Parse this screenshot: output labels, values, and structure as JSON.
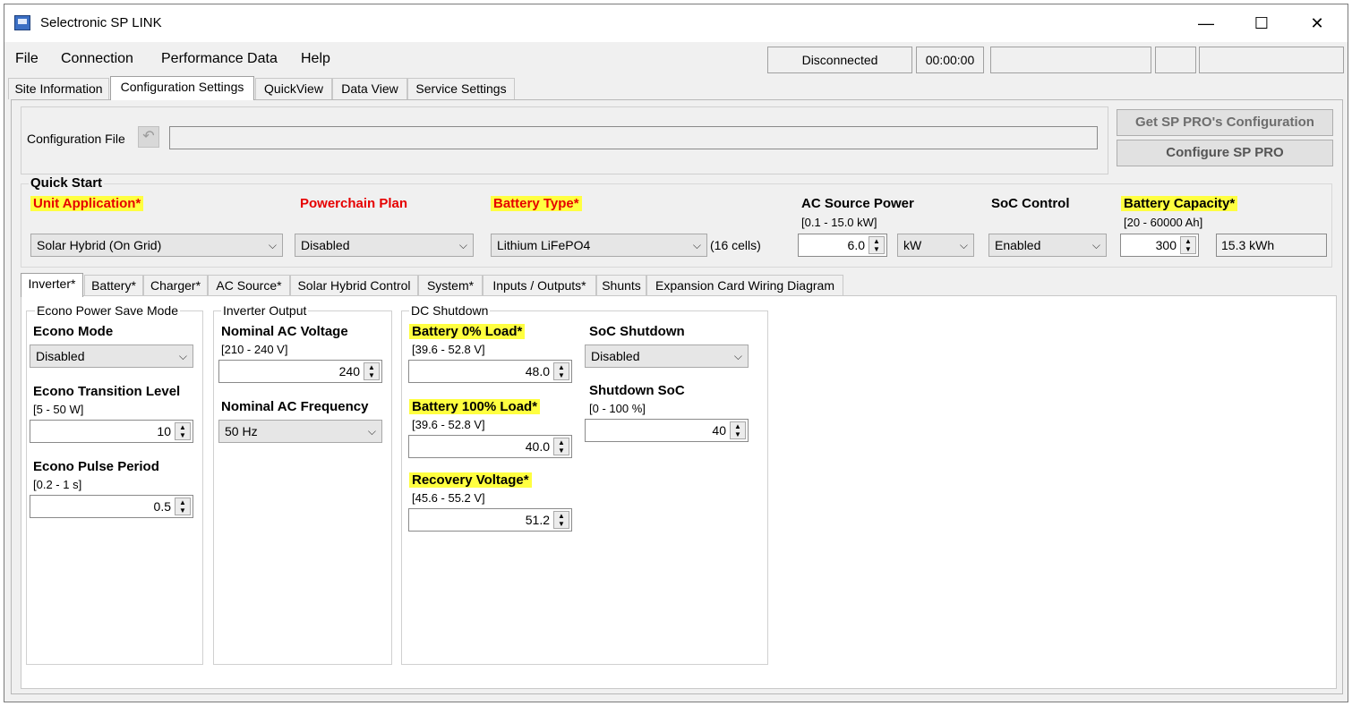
{
  "window": {
    "title": "Selectronic SP LINK",
    "minimize": "—",
    "maximize": "☐",
    "close": "✕"
  },
  "menu": {
    "file": "File",
    "connection": "Connection",
    "performance": "Performance Data",
    "help": "Help"
  },
  "status": {
    "connection": "Disconnected",
    "timer": "00:00:00"
  },
  "tabs": [
    "Site Information",
    "Configuration Settings",
    "QuickView",
    "Data View",
    "Service Settings"
  ],
  "config": {
    "file_label": "Configuration File",
    "file_value": "",
    "get_button": "Get SP PRO's Configuration",
    "configure_button": "Configure SP PRO"
  },
  "quickstart": {
    "title": "Quick Start",
    "unit_application": {
      "label": "Unit Application*",
      "value": "Solar Hybrid (On Grid)"
    },
    "powerchain": {
      "label": "Powerchain Plan",
      "value": "Disabled"
    },
    "battery_type": {
      "label": "Battery Type*",
      "value": "Lithium LiFePO4",
      "cells": "(16 cells)"
    },
    "ac_source": {
      "label": "AC Source Power",
      "range": "[0.1 - 15.0 kW]",
      "value": "6.0",
      "unit": "kW"
    },
    "soc_control": {
      "label": "SoC Control",
      "value": "Enabled"
    },
    "battery_capacity": {
      "label": "Battery Capacity*",
      "range": "[20 - 60000 Ah]",
      "value": "300",
      "kwh": "15.3 kWh"
    }
  },
  "subtabs": [
    "Inverter*",
    "Battery*",
    "Charger*",
    "AC Source*",
    "Solar Hybrid Control",
    "System*",
    "Inputs / Outputs*",
    "Shunts",
    "Expansion Card Wiring Diagram"
  ],
  "econo": {
    "group": "Econo Power Save Mode",
    "mode_label": "Econo Mode",
    "mode_value": "Disabled",
    "transition_label": "Econo Transition Level",
    "transition_range": "[5 - 50 W]",
    "transition_value": "10",
    "pulse_label": "Econo Pulse Period",
    "pulse_range": "[0.2 - 1 s]",
    "pulse_value": "0.5"
  },
  "inverter_output": {
    "group": "Inverter Output",
    "voltage_label": "Nominal AC Voltage",
    "voltage_range": "[210 - 240 V]",
    "voltage_value": "240",
    "freq_label": "Nominal AC Frequency",
    "freq_value": "50 Hz"
  },
  "dc_shutdown": {
    "group": "DC Shutdown",
    "b0_label": "Battery 0% Load*",
    "b0_range": "[39.6 - 52.8 V]",
    "b0_value": "48.0",
    "b100_label": "Battery 100% Load*",
    "b100_range": "[39.6 - 52.8 V]",
    "b100_value": "40.0",
    "rec_label": "Recovery Voltage*",
    "rec_range": "[45.6 - 55.2 V]",
    "rec_value": "51.2",
    "soc_sd_label": "SoC Shutdown",
    "soc_sd_value": "Disabled",
    "sd_soc_label": "Shutdown SoC",
    "sd_soc_range": "[0 - 100 %]",
    "sd_soc_value": "40"
  },
  "colors": {
    "highlight": "#ffff40",
    "required_red": "#e60000"
  }
}
